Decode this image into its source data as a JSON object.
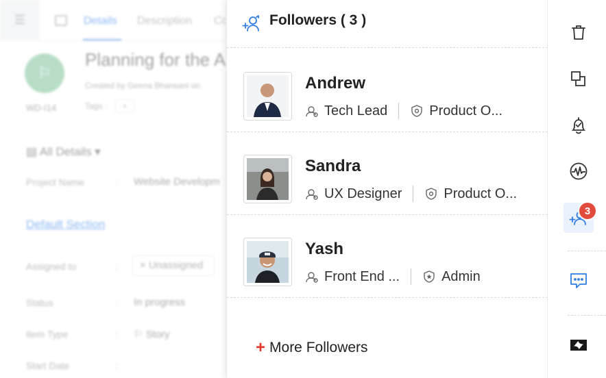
{
  "background": {
    "tabs": [
      "Details",
      "Description",
      "Co"
    ],
    "work_item_id": "WD-I14",
    "title": "Planning for the A",
    "created_by": "Created by Geena Bharwani on",
    "tags_label": "Tags :",
    "tags_add": "+",
    "all_details": "All Details",
    "fields": [
      {
        "label": "Project Name",
        "value": "Website Developm"
      },
      {
        "label": "Assigned to",
        "value": "Unassigned"
      },
      {
        "label": "Status",
        "value": "In progress"
      },
      {
        "label": "Item Type",
        "value": "Story"
      },
      {
        "label": "Start Date",
        "value": ""
      }
    ],
    "section_title": "Default Section"
  },
  "panel": {
    "title": "Followers ( 3 )",
    "followers": [
      {
        "name": "Andrew",
        "role": "Tech Lead",
        "profile": "Product O..."
      },
      {
        "name": "Sandra",
        "role": "UX Designer",
        "profile": "Product O..."
      },
      {
        "name": "Yash",
        "role": "Front End ...",
        "profile": "Admin"
      }
    ],
    "more_plus": "+",
    "more_label": "More Followers"
  },
  "rail": {
    "icons": [
      "trash-icon",
      "copy-icon",
      "reminder-bell-icon",
      "activity-icon",
      "followers-icon",
      "chat-icon",
      "zendesk-logo-icon"
    ],
    "followers_badge": "3",
    "accent": "#2f7ee6",
    "badge_color": "#e24c3d"
  }
}
